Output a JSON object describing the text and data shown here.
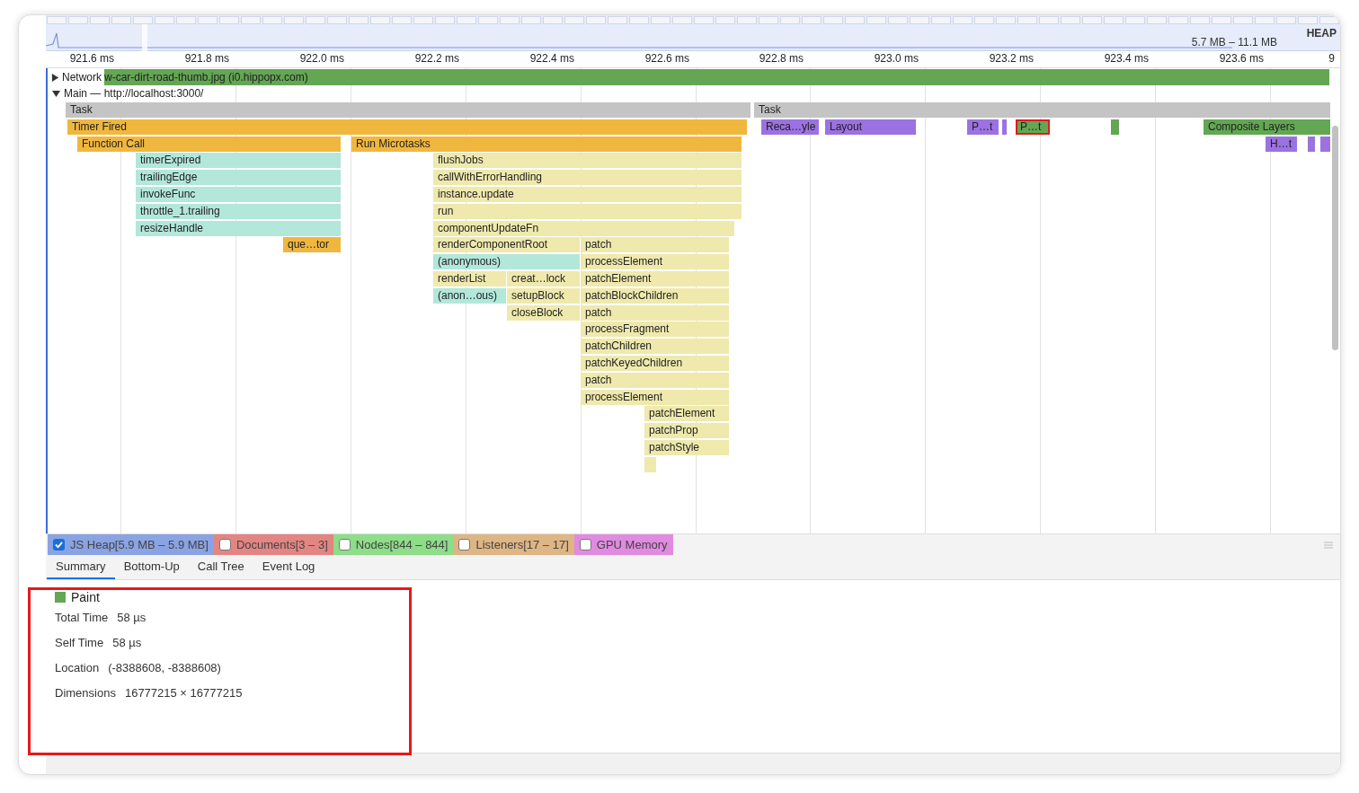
{
  "overview": {
    "heap_label": "HEAP",
    "heap_range": "5.7 MB – 11.1 MB"
  },
  "ruler": [
    "921.6 ms",
    "921.8 ms",
    "922.0 ms",
    "922.2 ms",
    "922.4 ms",
    "922.6 ms",
    "922.8 ms",
    "923.0 ms",
    "923.2 ms",
    "923.4 ms",
    "923.6 ms",
    "9"
  ],
  "tracks": [
    {
      "kind": "network",
      "label": "Network",
      "expanded": false,
      "text": "w-car-dirt-road-thumb.jpg (i0.hippopx.com)"
    },
    {
      "kind": "main",
      "label": "Main — http://localhost:3000/",
      "expanded": true
    }
  ],
  "flame": [
    {
      "label": "Task",
      "kind": "task",
      "selected": false
    },
    {
      "label": "Task",
      "kind": "task",
      "selected": false
    },
    {
      "label": "Timer Fired",
      "kind": "event",
      "selected": false
    },
    {
      "label": "Reca…yle",
      "kind": "rendering",
      "selected": false
    },
    {
      "label": "Layout",
      "kind": "rendering",
      "selected": false
    },
    {
      "label": "P…t",
      "kind": "rendering",
      "selected": false
    },
    {
      "kind": "rendering",
      "selected": false
    },
    {
      "label": "P…t",
      "kind": "painting",
      "selected": true
    },
    {
      "kind": "painting",
      "selected": false
    },
    {
      "kind": "painting",
      "selected": false
    },
    {
      "label": "Composite Layers",
      "kind": "painting",
      "selected": false
    },
    {
      "label": "Function Call",
      "kind": "event",
      "selected": false
    },
    {
      "label": "Run Microtasks",
      "kind": "event",
      "selected": false
    },
    {
      "label": "H…t",
      "kind": "rendering",
      "selected": false
    },
    {
      "kind": "rendering",
      "selected": false
    },
    {
      "kind": "rendering",
      "selected": false
    },
    {
      "label": "timerExpired",
      "kind": "function",
      "selected": false
    },
    {
      "label": "flushJobs",
      "kind": "framework",
      "selected": false
    },
    {
      "label": "trailingEdge",
      "kind": "function",
      "selected": false
    },
    {
      "label": "callWithErrorHandling",
      "kind": "framework",
      "selected": false
    },
    {
      "label": "invokeFunc",
      "kind": "function",
      "selected": false
    },
    {
      "label": "instance.update",
      "kind": "framework",
      "selected": false
    },
    {
      "label": "throttle_1.trailing",
      "kind": "function",
      "selected": false
    },
    {
      "label": "run",
      "kind": "framework",
      "selected": false
    },
    {
      "label": "resizeHandle",
      "kind": "function",
      "selected": false
    },
    {
      "label": "componentUpdateFn",
      "kind": "framework",
      "selected": false
    },
    {
      "label": "que…tor",
      "kind": "event",
      "selected": false
    },
    {
      "label": "renderComponentRoot",
      "kind": "framework",
      "selected": false
    },
    {
      "label": "patch",
      "kind": "framework",
      "selected": false
    },
    {
      "label": "(anonymous)",
      "kind": "function",
      "selected": false
    },
    {
      "label": "processElement",
      "kind": "framework",
      "selected": false
    },
    {
      "label": "renderList",
      "kind": "framework",
      "selected": false
    },
    {
      "label": "creat…lock",
      "kind": "framework",
      "selected": false
    },
    {
      "label": "patchElement",
      "kind": "framework",
      "selected": false
    },
    {
      "label": "(anon…ous)",
      "kind": "function",
      "selected": false
    },
    {
      "label": "setupBlock",
      "kind": "framework",
      "selected": false
    },
    {
      "label": "patchBlockChildren",
      "kind": "framework",
      "selected": false
    },
    {
      "label": "closeBlock",
      "kind": "framework",
      "selected": false
    },
    {
      "label": "patch",
      "kind": "framework",
      "selected": false
    },
    {
      "label": "processFragment",
      "kind": "framework",
      "selected": false
    },
    {
      "label": "patchChildren",
      "kind": "framework",
      "selected": false
    },
    {
      "label": "patchKeyedChildren",
      "kind": "framework",
      "selected": false
    },
    {
      "label": "patch",
      "kind": "framework",
      "selected": false
    },
    {
      "label": "processElement",
      "kind": "framework",
      "selected": false
    },
    {
      "label": "patchElement",
      "kind": "framework",
      "selected": false
    },
    {
      "label": "patchProp",
      "kind": "framework",
      "selected": false
    },
    {
      "label": "patchStyle",
      "kind": "framework",
      "selected": false
    },
    {
      "kind": "framework",
      "selected": false
    }
  ],
  "counters": [
    {
      "label": "JS Heap[5.9 MB – 5.9 MB]",
      "checked": true,
      "color": "#8aa3e3"
    },
    {
      "label": "Documents[3 – 3]",
      "checked": false,
      "color": "#e38583"
    },
    {
      "label": "Nodes[844 – 844]",
      "checked": false,
      "color": "#8edd88"
    },
    {
      "label": "Listeners[17 – 17]",
      "checked": false,
      "color": "#deb584"
    },
    {
      "label": "GPU Memory",
      "checked": false,
      "color": "#e08be0"
    }
  ],
  "tabs": [
    {
      "label": "Summary",
      "selected": true
    },
    {
      "label": "Bottom-Up",
      "selected": false
    },
    {
      "label": "Call Tree",
      "selected": false
    },
    {
      "label": "Event Log",
      "selected": false
    }
  ],
  "summary": {
    "color": "#63a653",
    "title": "Paint",
    "rows": [
      {
        "label": "Total Time",
        "value": "58 µs"
      },
      {
        "label": "Self Time",
        "value": "58 µs"
      },
      {
        "label": "Location",
        "value": "(-8388608, -8388608)"
      },
      {
        "label": "Dimensions",
        "value": "16777215 × 16777215"
      }
    ]
  }
}
